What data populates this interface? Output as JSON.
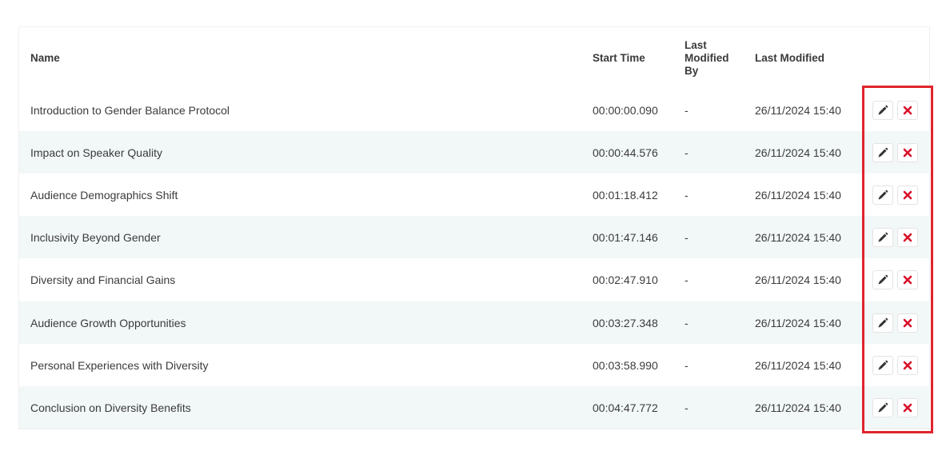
{
  "table": {
    "headers": {
      "name": "Name",
      "start_time": "Start Time",
      "last_modified_by": "Last Modified By",
      "last_modified": "Last Modified"
    },
    "rows": [
      {
        "name": "Introduction to Gender Balance Protocol",
        "start_time": "00:00:00.090",
        "last_modified_by": "-",
        "last_modified": "26/11/2024 15:40"
      },
      {
        "name": "Impact on Speaker Quality",
        "start_time": "00:00:44.576",
        "last_modified_by": "-",
        "last_modified": "26/11/2024 15:40"
      },
      {
        "name": "Audience Demographics Shift",
        "start_time": "00:01:18.412",
        "last_modified_by": "-",
        "last_modified": "26/11/2024 15:40"
      },
      {
        "name": "Inclusivity Beyond Gender",
        "start_time": "00:01:47.146",
        "last_modified_by": "-",
        "last_modified": "26/11/2024 15:40"
      },
      {
        "name": "Diversity and Financial Gains",
        "start_time": "00:02:47.910",
        "last_modified_by": "-",
        "last_modified": "26/11/2024 15:40"
      },
      {
        "name": "Audience Growth Opportunities",
        "start_time": "00:03:27.348",
        "last_modified_by": "-",
        "last_modified": "26/11/2024 15:40"
      },
      {
        "name": "Personal Experiences with Diversity",
        "start_time": "00:03:58.990",
        "last_modified_by": "-",
        "last_modified": "26/11/2024 15:40"
      },
      {
        "name": "Conclusion on Diversity Benefits",
        "start_time": "00:04:47.772",
        "last_modified_by": "-",
        "last_modified": "26/11/2024 15:40"
      }
    ],
    "actions": {
      "edit_icon": "pencil-icon",
      "delete_icon": "close-icon"
    }
  },
  "colors": {
    "row_alt_background": "#f2f7f7",
    "delete_icon": "#d9112a",
    "edit_icon": "#333333",
    "highlight_border": "#e0242c"
  }
}
